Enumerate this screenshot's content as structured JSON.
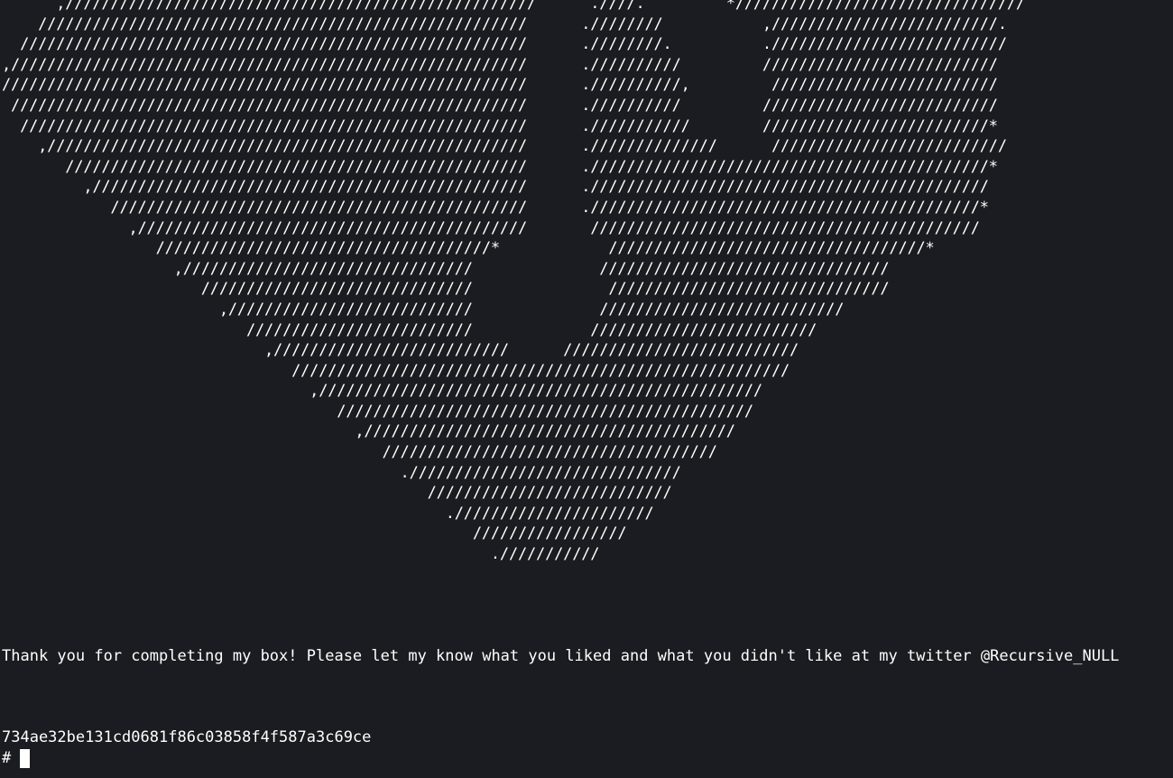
{
  "terminal": {
    "ascii_art": "      ,////////////////////////////////////////////////////      .////.         *////////////////////////////////\n    //////////////////////////////////////////////////////      .////////           ,/////////////////////////.\n  ////////////////////////////////////////////////////////      .////////.          .//////////////////////////\n,/////////////////////////////////////////////////////////      .//////////         //////////////////////////\n//////////////////////////////////////////////////////////      .//////////,         /////////////////////////\n /////////////////////////////////////////////////////////      .//////////         //////////////////////////\n  ////////////////////////////////////////////////////////      .///////////        /////////////////////////*\n    ,/////////////////////////////////////////////////////      .//////////////      //////////////////////////\n       ///////////////////////////////////////////////////      .////////////////////////////////////////////*\n         ,////////////////////////////////////////////////      .////////////////////////////////////////////\n            //////////////////////////////////////////////      .///////////////////////////////////////////*\n              ,///////////////////////////////////////////       ///////////////////////////////////////////\n                 /////////////////////////////////////*            ///////////////////////////////////*\n                   ,////////////////////////////////              ////////////////////////////////\n                      //////////////////////////////               ///////////////////////////////\n                        ,///////////////////////////              ///////////////////////////\n                           /////////////////////////             /////////////////////////\n                             ,//////////////////////////      //////////////////////////\n                                ///////////////////////////////////////////////////////\n                                  ,/////////////////////////////////////////////////\n                                     //////////////////////////////////////////////\n                                       ,/////////////////////////////////////////\n                                          /////////////////////////////////////\n                                            .//////////////////////////////\n                                               ///////////////////////////\n                                                 .//////////////////////\n                                                    /////////////////\n                                                      .///////////",
    "thanks_message": "Thank you for completing my box! Please let my know what you liked and what you didn't like at my twitter @Recursive_NULL",
    "flag_hash": "734ae32be131cd0681f86c03858f4f587a3c69ce",
    "prompt": "#"
  }
}
